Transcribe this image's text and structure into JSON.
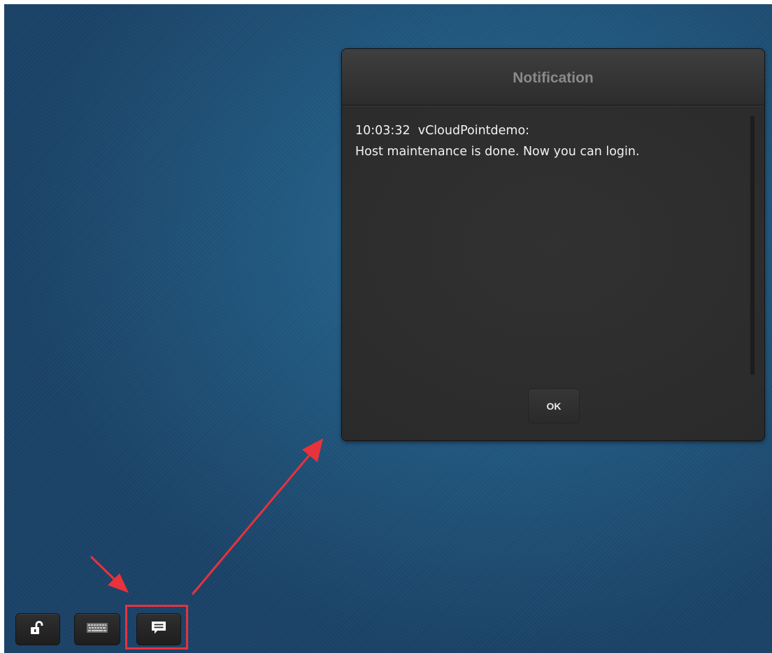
{
  "dialog": {
    "title": "Notification",
    "message_header": "10:03:32  vCloudPointdemo:",
    "message_body": "Host maintenance is done. Now you can login.",
    "ok_label": "OK"
  },
  "taskbar": {
    "buttons": [
      {
        "icon": "unlock-icon"
      },
      {
        "icon": "keyboard-icon"
      },
      {
        "icon": "message-icon"
      }
    ]
  },
  "annotations": {
    "color": "#e8323c",
    "highlighted": "message-icon"
  },
  "colors": {
    "desktop_blue": "#21587f",
    "dialog_bg": "#2d2d2d",
    "title_text": "#8a8a8a",
    "body_text": "#f1f1f1"
  }
}
